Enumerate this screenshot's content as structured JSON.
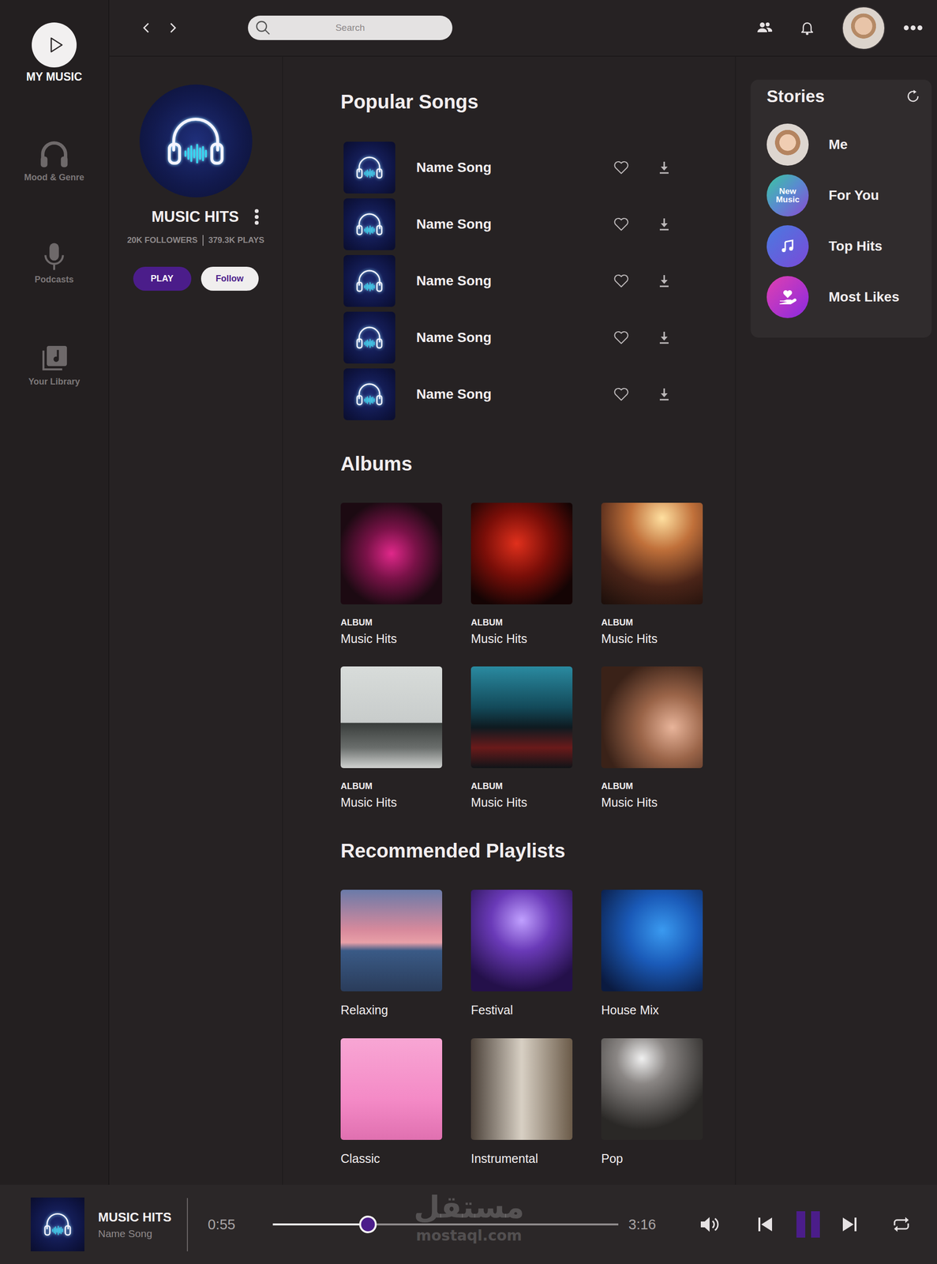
{
  "sidebar": {
    "items": [
      {
        "label": "MY MUSIC",
        "kind": "logo",
        "selected": true
      },
      {
        "label": "Mood & Genre",
        "kind": "nav",
        "selected": false
      },
      {
        "label": "Podcasts",
        "kind": "nav",
        "selected": false
      },
      {
        "label": "Your Library",
        "kind": "nav",
        "selected": false
      }
    ]
  },
  "top_bar": {
    "search": {
      "placeholder": "Search"
    }
  },
  "profile": {
    "title": "MUSIC HITS",
    "followers": "20K FOLLOWERS",
    "plays": "379.3K PLAYS",
    "play_button": "PLAY",
    "follow_button": "Follow"
  },
  "popular_songs": {
    "title": "Popular Songs",
    "songs": [
      {
        "name": "Name Song",
        "liked": false
      },
      {
        "name": "Name Song",
        "liked": false
      },
      {
        "name": "Name Song",
        "liked": false
      },
      {
        "name": "Name Song",
        "liked": false
      },
      {
        "name": "Name Song",
        "liked": false
      }
    ]
  },
  "albums": {
    "title": "Albums",
    "items": [
      {
        "type": "ALBUM",
        "name": "Music Hits"
      },
      {
        "type": "ALBUM",
        "name": "Music Hits"
      },
      {
        "type": "ALBUM",
        "name": "Music Hits"
      },
      {
        "type": "ALBUM",
        "name": "Music Hits"
      },
      {
        "type": "ALBUM",
        "name": "Music Hits"
      },
      {
        "type": "ALBUM",
        "name": "Music Hits"
      }
    ]
  },
  "playlists": {
    "title": "Recommended Playlists",
    "items": [
      {
        "name": "Relaxing"
      },
      {
        "name": "Festival"
      },
      {
        "name": "House Mix"
      },
      {
        "name": "Classic"
      },
      {
        "name": "Instrumental"
      },
      {
        "name": "Pop"
      }
    ]
  },
  "stories": {
    "title": "Stories",
    "items": [
      {
        "label": "Me",
        "kind": "photo",
        "badge": ""
      },
      {
        "label": "For You",
        "kind": "badge",
        "badge": "New Music"
      },
      {
        "label": "Top Hits",
        "kind": "note",
        "badge": ""
      },
      {
        "label": "Most Likes",
        "kind": "heart",
        "badge": ""
      }
    ]
  },
  "player": {
    "title": "MUSIC HITS",
    "song": "Name Song",
    "elapsed": "0:55",
    "duration": "3:16",
    "level": 0.275,
    "playing": true
  },
  "watermark": {
    "arabic": "مستقل",
    "latin": "mostaql.com"
  }
}
